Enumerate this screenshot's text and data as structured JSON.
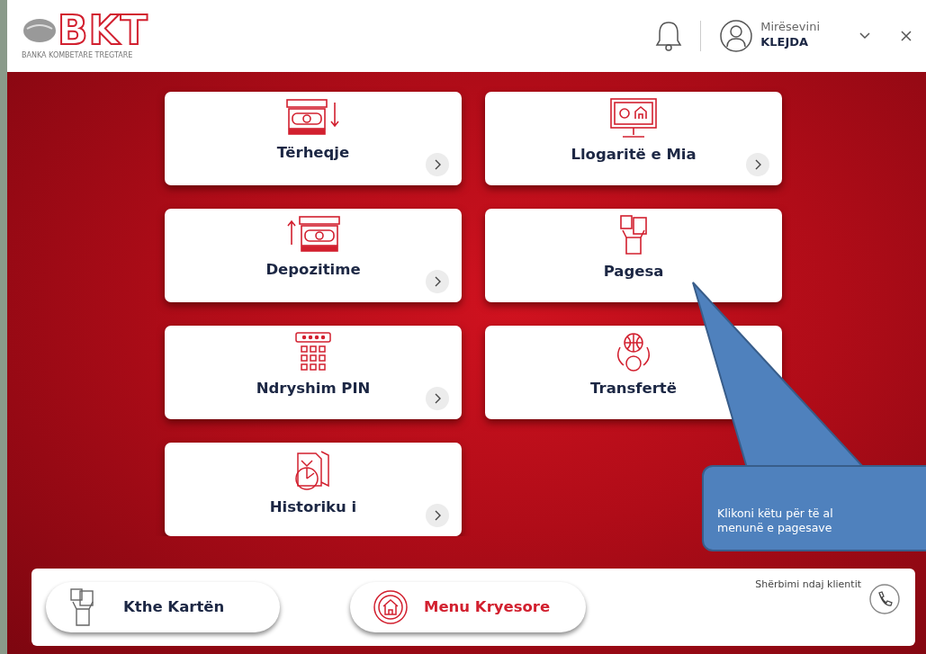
{
  "header": {
    "logo_text": "BKT",
    "logo_subtitle": "BANKA KOMBETARE TREGTARE",
    "greeting": "Mirësevini",
    "user_name": "KLEJDA"
  },
  "tiles": [
    {
      "label": "Tërheqje",
      "kind": "withdraw"
    },
    {
      "label": "Llogaritë e Mia",
      "kind": "accounts"
    },
    {
      "label": "Depozitime",
      "kind": "deposit"
    },
    {
      "label": "Pagesa",
      "kind": "payments"
    },
    {
      "label": "Ndryshim PIN",
      "kind": "pin"
    },
    {
      "label": "Transfertë",
      "kind": "transfer"
    },
    {
      "label": "Historiku i",
      "kind": "history"
    }
  ],
  "footer": {
    "buttons": [
      {
        "label": "Kthe Kartën",
        "kind": "card"
      },
      {
        "label": "Menu Kryesore",
        "kind": "home"
      }
    ],
    "support_label": "Shërbimi ndaj klientit"
  },
  "callout": {
    "lines": [
      "Klikoni këtu për të al",
      "menunë e pagesave"
    ]
  }
}
